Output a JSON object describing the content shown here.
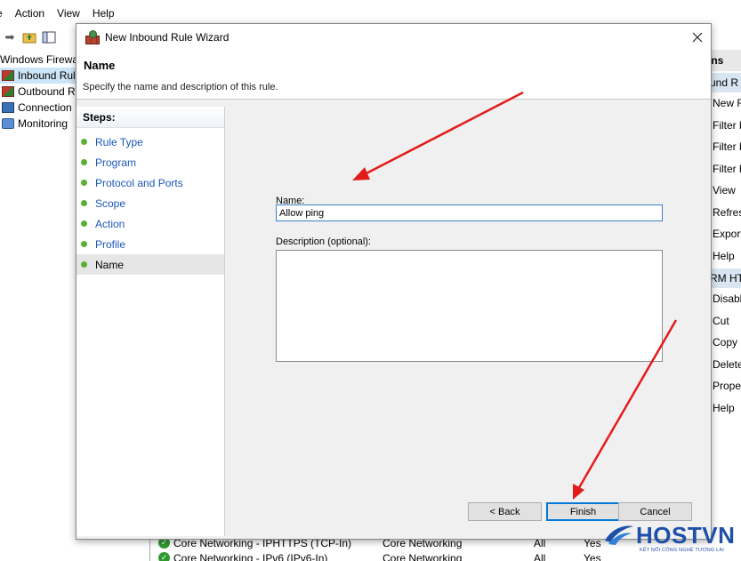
{
  "menubar": {
    "items": [
      "e",
      "Action",
      "View",
      "Help"
    ]
  },
  "tree": {
    "items": [
      "Windows Firewa",
      "Inbound Rul",
      "Outbound R",
      "Connection",
      "Monitoring"
    ]
  },
  "actions": {
    "header": "ons",
    "sub1": "und R",
    "group1": [
      "New R",
      "Filter b",
      "Filter b",
      "Filter b",
      "View",
      "Refres",
      "Export",
      "Help"
    ],
    "sub2": "RM HT",
    "group2": [
      "Disabl",
      "Cut",
      "Copy",
      "Delete",
      "Prope",
      "Help"
    ]
  },
  "rules": [
    {
      "name": "Core Networking - IPHTTPS (TCP-In)",
      "group": "Core Networking",
      "profile": "All",
      "enabled": "Yes"
    },
    {
      "name": "Core Networking - IPv6 (IPv6-In)",
      "group": "Core Networking",
      "profile": "All",
      "enabled": "Yes"
    }
  ],
  "wizard": {
    "title": "New Inbound Rule Wizard",
    "heading": "Name",
    "subheading": "Specify the name and description of this rule.",
    "steps_title": "Steps:",
    "steps": [
      "Rule Type",
      "Program",
      "Protocol and Ports",
      "Scope",
      "Action",
      "Profile",
      "Name"
    ],
    "name_label": "Name:",
    "name_value": "Allow ping",
    "description_label": "Description (optional):",
    "description_value": "",
    "buttons": {
      "back": "< Back",
      "finish": "Finish",
      "cancel": "Cancel"
    }
  },
  "logo": {
    "wordmark": "HOSTVN",
    "tagline": "KẾT NỐI CÔNG NGHỆ TƯƠNG LAI"
  },
  "colors": {
    "accent": "#0078d7",
    "step_link": "#1a56b8",
    "annotation_arrow": "#e41b1b",
    "logo": "#1e50a8"
  }
}
